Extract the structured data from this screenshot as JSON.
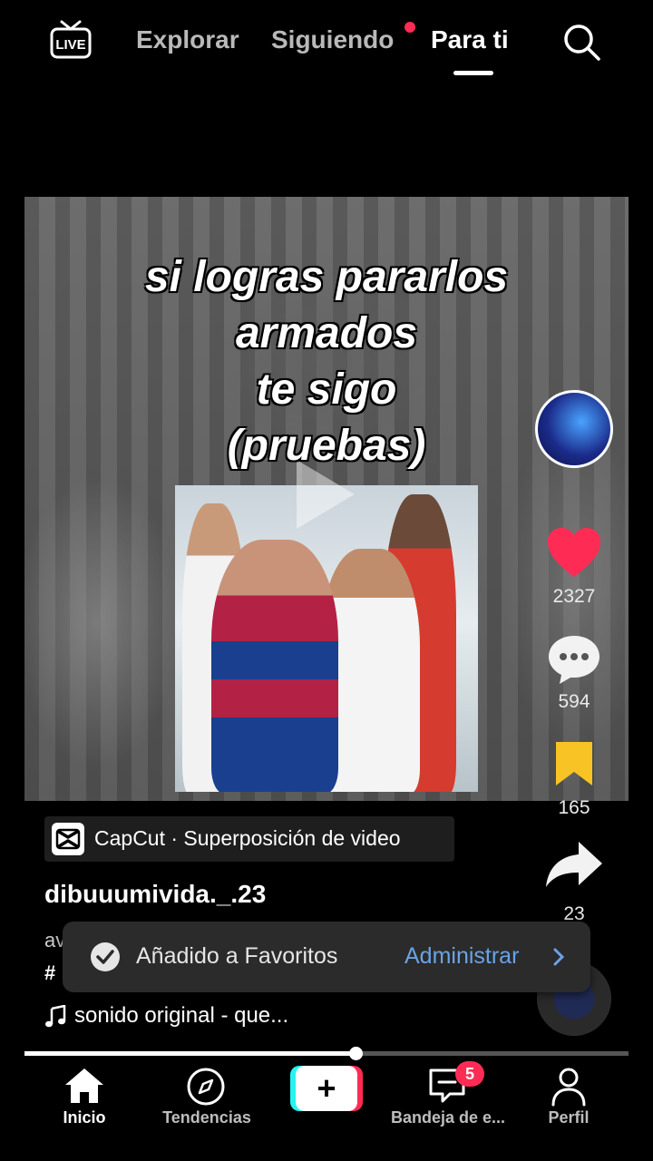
{
  "header": {
    "live_label": "LIVE",
    "tabs": [
      "Explorar",
      "Siguiendo",
      "Para ti"
    ],
    "active_tab": "Para ti"
  },
  "video": {
    "caption_lines": [
      "si logras pararlos",
      "armados",
      "te sigo",
      "(pruebas)"
    ]
  },
  "actions": {
    "likes": "2327",
    "comments": "594",
    "favorites": "165",
    "shares": "23"
  },
  "post": {
    "capcut_label": "CapCut · Superposición de video",
    "username": "dibuuumivida._.23",
    "description_partial": "av",
    "hashtag_partial": "#",
    "sound_name": "sonido original - que..."
  },
  "toast": {
    "message": "Añadido a Favoritos",
    "action_label": "Administrar"
  },
  "progress": {
    "fraction": 0.55
  },
  "nav": {
    "home": "Inicio",
    "trends": "Tendencias",
    "create": "+",
    "inbox": "Bandeja de e...",
    "inbox_badge": "5",
    "profile": "Perfil"
  },
  "colors": {
    "accent": "#fe2c55",
    "link": "#6aa3e6",
    "bookmark": "#f7c325",
    "create_cyan": "#25f4ee"
  }
}
